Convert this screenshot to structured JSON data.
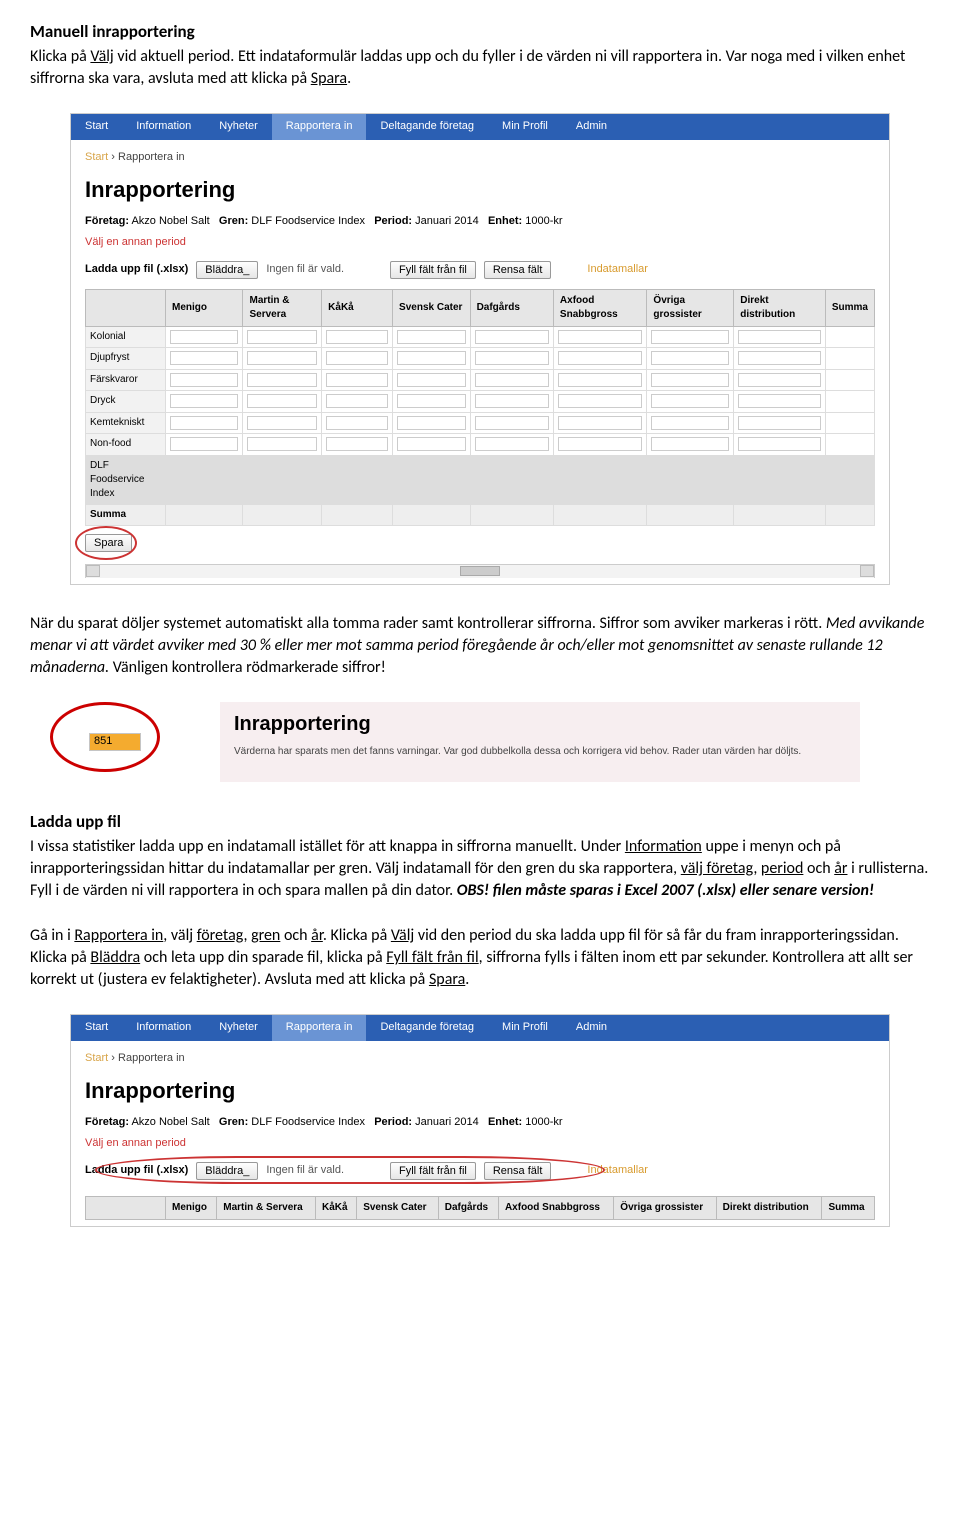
{
  "doc": {
    "h1": "Manuell inrapportering",
    "p1a": "Klicka på ",
    "p1u1": "Välj",
    "p1b": " vid aktuell period. Ett indataformulär laddas upp och du fyller i de värden ni vill rapportera in. Var noga med i vilken enhet siffrorna ska vara, avsluta med att klicka på ",
    "p1u2": "Spara",
    "p1c": ".",
    "p2a": "När du sparat döljer systemet automatiskt alla tomma rader samt kontrollerar siffrorna. Siffror som avviker markeras i rött. ",
    "p2i": "Med avvikande menar vi att värdet avviker med 30 % eller mer mot samma period föregående år och/eller mot genomsnittet av senaste rullande 12 månaderna.",
    "p2b": " Vänligen kontrollera rödmarkerade siffror!",
    "h2": "Ladda upp fil",
    "p3a": "I vissa statistiker ladda upp en indatamall istället för att knappa in siffrorna manuellt. Under ",
    "p3u1": "Information",
    "p3b": " uppe i menyn och på inrapporteringssidan hittar du indatamallar per gren. Välj indatamall för den gren du ska rapportera, ",
    "p3u2": "välj företag",
    "p3c": ", ",
    "p3u3": "period",
    "p3d": " och ",
    "p3u4": "år",
    "p3e": " i rullisterna. Fyll i de värden ni vill rapportera in och spara mallen på din dator. ",
    "p3bi": "OBS! filen måste sparas i Excel 2007 (.xlsx) eller senare version!",
    "p4a": "Gå in i ",
    "p4u1": "Rapportera in",
    "p4b": ", välj ",
    "p4u2": "företag",
    "p4c": ", ",
    "p4u3": "gren",
    "p4d": " och ",
    "p4u4": "år",
    "p4e": ". Klicka på ",
    "p4u5": "Välj",
    "p4f": " vid den period du ska ladda upp fil för så får du fram inrapporteringssidan. Klicka på ",
    "p4u6": "Bläddra",
    "p4g": " och leta upp din sparade fil, klicka på ",
    "p4u7": "Fyll fält från fil",
    "p4h": ", siffrorna fylls i fälten inom ett par sekunder. Kontrollera att allt ser korrekt ut (justera ev felaktigheter). Avsluta med att klicka på ",
    "p4u8": "Spara",
    "p4i": "."
  },
  "app": {
    "nav": {
      "start": "Start",
      "info": "Information",
      "nyheter": "Nyheter",
      "rapportera": "Rapportera in",
      "deltagande": "Deltagande företag",
      "profil": "Min Profil",
      "admin": "Admin"
    },
    "breadcrumb": {
      "a": "Start",
      "sep": " › ",
      "b": "Rapportera in"
    },
    "title": "Inrapportering",
    "meta": {
      "foretag_l": "Företag:",
      "foretag_v": "Akzo Nobel Salt",
      "gren_l": "Gren:",
      "gren_v": "DLF Foodservice Index",
      "period_l": "Period:",
      "period_v": "Januari 2014",
      "enhet_l": "Enhet:",
      "enhet_v": "1000-kr"
    },
    "choose": "Välj en annan period",
    "toolbar": {
      "upload_l": "Ladda upp fil (.xlsx)",
      "browse": "Bläddra_",
      "nofile": "Ingen fil är vald.",
      "fill": "Fyll fält från fil",
      "clear": "Rensa fält",
      "mallar": "Indatamallar"
    },
    "cols": {
      "empty": "",
      "menigo": "Menigo",
      "martin": "Martin & Servera",
      "kaka": "KåKå",
      "svensk": "Svensk Cater",
      "dafgards": "Dafgårds",
      "axfood": "Axfood Snabbgross",
      "ovriga": "Övriga grossister",
      "direkt": "Direkt distribution",
      "summa": "Summa"
    },
    "rows": {
      "kolonial": "Kolonial",
      "djupfryst": "Djupfryst",
      "farskvaror": "Färskvaror",
      "dryck": "Dryck",
      "kemtekniskt": "Kemtekniskt",
      "nonfood": "Non-food",
      "dlf": "DLF Foodservice Index",
      "summa": "Summa"
    },
    "save": "Spara"
  },
  "snippet2": {
    "value": "851",
    "title": "Inrapportering",
    "msg": "Värderna har sparats men det fanns varningar. Var god dubbelkolla dessa och korrigera vid behov. Rader utan värden har döljts."
  }
}
